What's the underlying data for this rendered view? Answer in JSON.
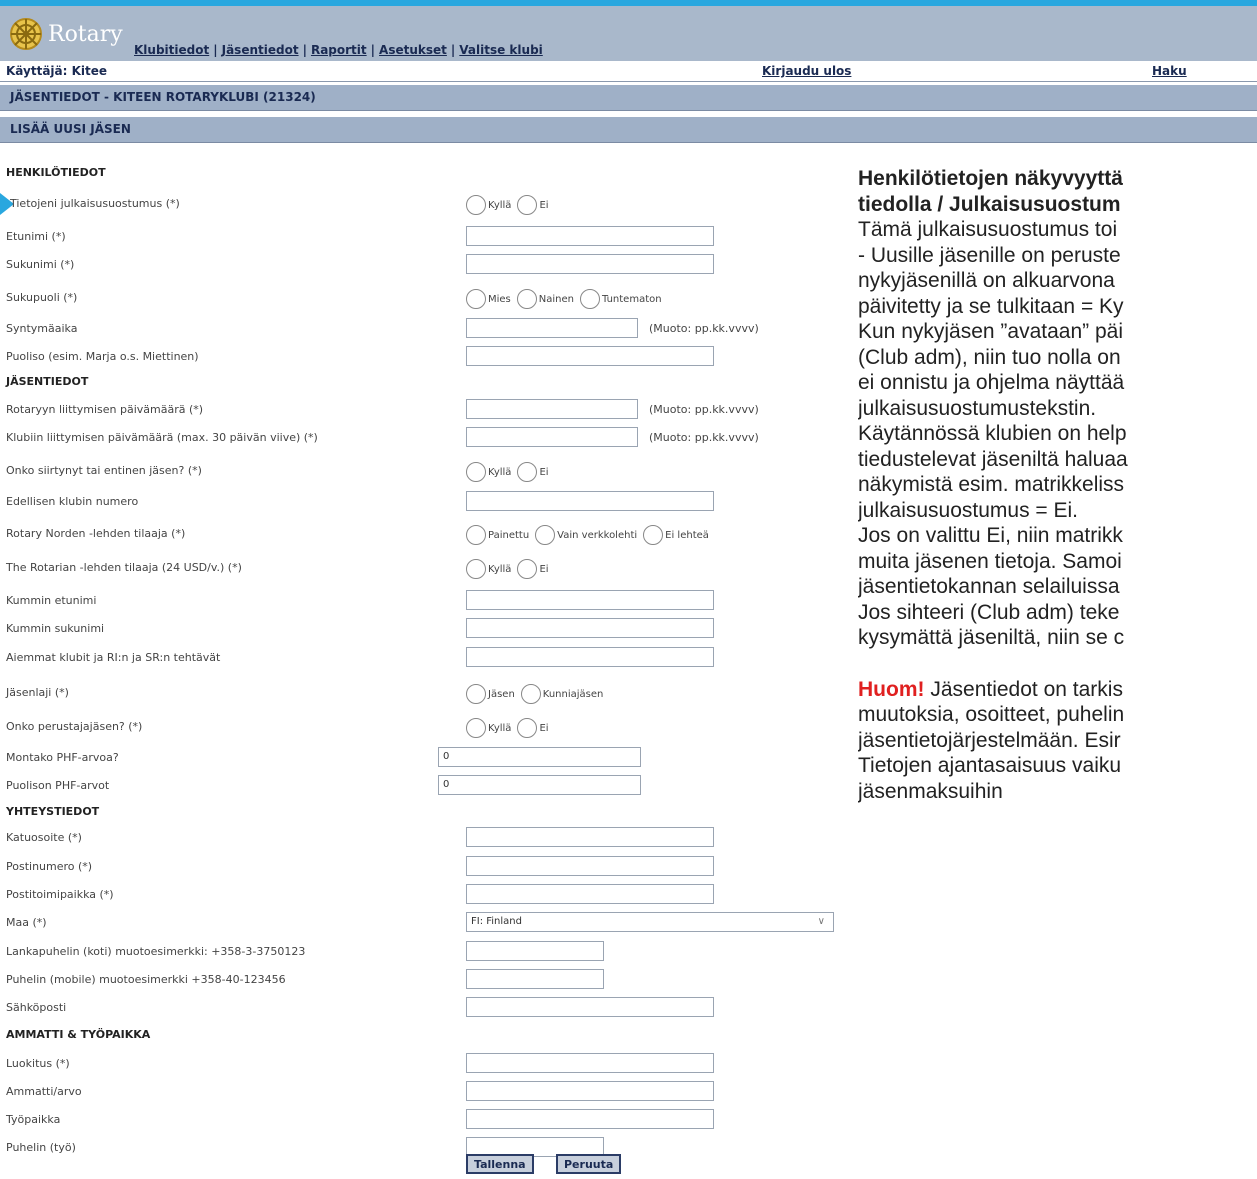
{
  "header": {
    "logo_text": "Rotary",
    "nav": [
      "Klubitiedot",
      "Jäsentiedot",
      "Raportit",
      "Asetukset",
      "Valitse klubi"
    ]
  },
  "userbar": {
    "user": "Käyttäjä: Kitee",
    "logout": "Kirjaudu ulos",
    "search": "Haku"
  },
  "bars": {
    "title": "JÄSENTIEDOT - KITEEN ROTARYKLUBI (21324)",
    "subtitle": "LISÄÄ UUSI JÄSEN"
  },
  "form": {
    "sections": {
      "personal": "HENKILÖTIEDOT",
      "member": "JÄSENTIEDOT",
      "contact": "YHTEYSTIEDOT",
      "work": "AMMATTI & TYÖPAIKKA"
    },
    "labels": {
      "consent": "Tietojeni julkaisusuostumus (*)",
      "firstname": "Etunimi (*)",
      "lastname": "Sukunimi (*)",
      "gender": "Sukupuoli (*)",
      "birthdate": "Syntymäaika",
      "spouse": "Puoliso (esim. Marja o.s. Miettinen)",
      "rotary_join": "Rotaryyn liittymisen päivämäärä (*)",
      "club_join": "Klubiin liittymisen päivämäärä (max. 30 päivän viive) (*)",
      "transferred": "Onko siirtynyt tai entinen jäsen? (*)",
      "prev_club": "Edellisen klubin numero",
      "norden": "Rotary Norden -lehden tilaaja (*)",
      "rotarian": "The Rotarian -lehden tilaaja (24 USD/v.) (*)",
      "sponsor_first": "Kummin etunimi",
      "sponsor_last": "Kummin sukunimi",
      "prev_clubs": "Aiemmat klubit ja RI:n ja SR:n tehtävät",
      "member_type": "Jäsenlaji (*)",
      "founder": "Onko perustajajäsen? (*)",
      "phf": "Montako PHF-arvoa?",
      "spouse_phf": "Puolison PHF-arvot",
      "street": "Katuosoite (*)",
      "postcode": "Postinumero (*)",
      "city": "Postitoimipaikka (*)",
      "country": "Maa (*)",
      "landline": "Lankapuhelin (koti) muotoesimerkki: +358-3-3750123",
      "mobile": "Puhelin (mobile) muotoesimerkki +358-40-123456",
      "email": "Sähköposti",
      "classification": "Luokitus (*)",
      "profession": "Ammatti/arvo",
      "workplace": "Työpaikka",
      "work_phone": "Puhelin (työ)"
    },
    "radios": {
      "yes": "Kyllä",
      "no": "Ei",
      "male": "Mies",
      "female": "Nainen",
      "unknown": "Tuntematon",
      "printed": "Painettu",
      "online": "Vain verkkolehti",
      "none": "Ei lehteä",
      "member": "Jäsen",
      "honorary": "Kunniajäsen"
    },
    "date_hint": "(Muoto: pp.kk.vvvv)",
    "values": {
      "phf": "0",
      "spouse_phf": "0",
      "country": "FI: Finland"
    },
    "buttons": {
      "save": "Tallenna",
      "cancel": "Peruuta"
    }
  },
  "side": {
    "title_lines": [
      "Henkilötietojen näkyvyyttä",
      "tiedolla / Julkaisusuostum"
    ],
    "body_lines": [
      "Tämä julkaisusuostumus toi",
      "- Uusille jäsenille on peruste",
      "nykyjäsenillä on alkuarvona",
      "päivitetty ja se tulkitaan = Ky",
      "Kun nykyjäsen ”avataan” päi",
      "(Club adm), niin tuo nolla on",
      "ei onnistu ja ohjelma näyttää",
      "julkaisusuostumustekstin.",
      "Käytännössä klubien on help",
      "tiedustelevat jäseniltä haluaa",
      "näkymistä esim. matrikkeliss",
      "julkaisusuostumus = Ei.",
      "Jos on valittu Ei, niin matrikk",
      "muita jäsenen tietoja. Samoi",
      "jäsentietokannan selailuissa",
      "Jos sihteeri (Club adm) teke",
      "kysymättä jäseniltä, niin se c"
    ],
    "huom_label": "Huom!",
    "huom_lines": [
      " Jäsentiedot on tarkis",
      "muutoksia, osoitteet, puhelin",
      "jäsentietojärjestelmään. Esir",
      "Tietojen ajantasaisuus vaiku",
      "jäsenmaksuihin"
    ],
    "colors": {
      "accent": "#29a7df",
      "huom": "#e02020"
    }
  }
}
